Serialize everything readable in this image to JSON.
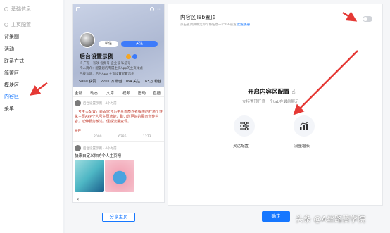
{
  "sidebar": {
    "items": [
      {
        "label": "基础信息"
      },
      {
        "label": "主页配置"
      },
      {
        "label": "背景图"
      },
      {
        "label": "活动"
      },
      {
        "label": "联系方式"
      },
      {
        "label": "简置区"
      },
      {
        "label": "模块区"
      },
      {
        "label": "内容区"
      },
      {
        "label": "菜单"
      }
    ]
  },
  "phone": {
    "follow_label": "私信",
    "followed_label": "关注",
    "name": "后台设置示例",
    "line1": "IP 广东 · 有效 视频号 企业号 私信号",
    "line2": "个人简介：配置您的专属主页App的主页样式",
    "line3": "已接认证：后台App 主页设置配置示例",
    "stats": [
      "5860 获赞",
      "2701 万 粉丝",
      "164 关注",
      "165万 粉丝"
    ],
    "tabs": [
      "全部",
      "动态",
      "文章",
      "视频",
      "图动",
      "直播"
    ],
    "post1": {
      "author": "后台设置示例 · 4小时前",
      "title": "「号主页配置」",
      "body": "「号主页配置」是百家号为平台优质作者提供的打造个性化主页APP个人号主页功能，助力您更好的展示创作内容，延伸服务触达，促成流量变现。",
      "more": "展开",
      "comments": "2000",
      "likes": "6286",
      "shares": "1273"
    },
    "post2": {
      "author": "后台设置示例 · 4小时前",
      "title": "快来自定义你的个人主页吧！"
    }
  },
  "share_button": "分享主页",
  "panel": {
    "title": "内容区Tab置顶",
    "desc": "点击置顶并确定即可将任意一个Tab前置",
    "desc_link": "配置手册",
    "empty_title": "开启内容区配置",
    "empty_desc": "支持置顶任意一个tab在最前展示",
    "option1": "灵活配置",
    "option2": "流量增长"
  },
  "confirm_button": "确定",
  "watermark": "头条 @A丝路赞学院",
  "colors": {
    "accent": "#1677ff",
    "arrow": "#e53935"
  }
}
